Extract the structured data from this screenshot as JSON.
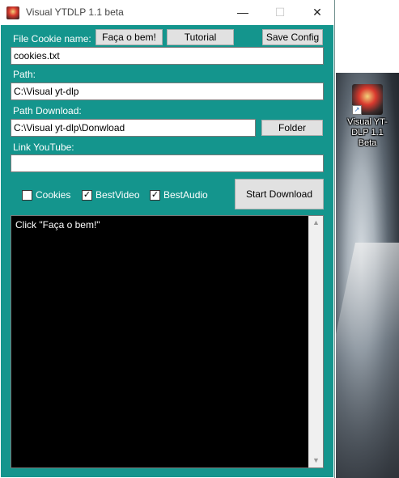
{
  "window": {
    "title": "Visual YTDLP 1.1 beta",
    "controls": {
      "minimize": "—",
      "maximize": "☐",
      "close": "✕"
    }
  },
  "form": {
    "cookie_label": "File Cookie name:",
    "cookie_value": "cookies.txt",
    "faca_button": "Faça o bem!",
    "tutorial_button": "Tutorial",
    "save_config_button": "Save Config",
    "path_label": "Path:",
    "path_value": "C:\\Visual yt-dlp",
    "path_download_label": "Path Download:",
    "path_download_value": "C:\\Visual yt-dlp\\Donwload",
    "folder_button": "Folder",
    "link_label": "Link YouTube:",
    "link_value": "",
    "checkboxes": [
      {
        "label": "Cookies",
        "checked": false
      },
      {
        "label": "BestVideo",
        "checked": true
      },
      {
        "label": "BestAudio",
        "checked": true
      }
    ],
    "start_button": "Start Download"
  },
  "log": {
    "text": "Click \"Faça o bem!\""
  },
  "desktop": {
    "icon_label": "Visual YT-DLP 1.1 Beta"
  },
  "colors": {
    "client_background": "#14958d",
    "log_background": "#000000"
  }
}
